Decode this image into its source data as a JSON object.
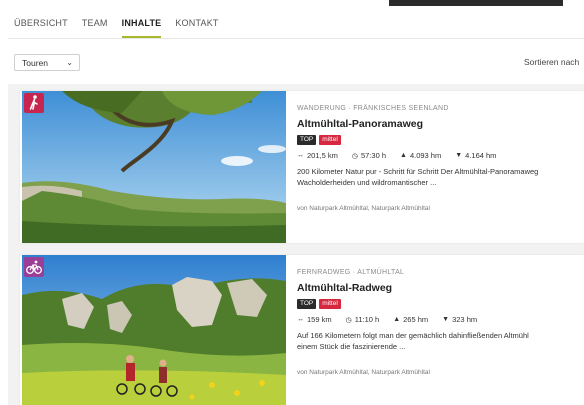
{
  "tabs": [
    {
      "label": "ÜBERSICHT"
    },
    {
      "label": "TEAM"
    },
    {
      "label": "INHALTE"
    },
    {
      "label": "KONTAKT"
    }
  ],
  "active_tab": "INHALTE",
  "filter": {
    "selected": "Touren"
  },
  "sort": {
    "label": "Sortieren nach"
  },
  "colors": {
    "accent": "#a7b92b",
    "hike_badge": "#c7264f",
    "bike_badge": "#9a3e98",
    "difficulty_badge": "#d6293f"
  },
  "tours": [
    {
      "category_icon": "hiking-icon",
      "meta": "WANDERUNG · FRÄNKISCHES SEENLAND",
      "title": "Altmühltal-Panoramaweg",
      "badge_top": "TOP",
      "badge_difficulty": "mittel",
      "distance": "201,5 km",
      "duration": "57:30 h",
      "ascent": "4.093 hm",
      "descent": "4.164 hm",
      "desc_line1": "200 Kilometer Natur pur - Schritt für Schritt Der Altmühltal-Panoramaweg",
      "desc_line2": "Wacholderheiden und wildromantischer ...",
      "author": "von Naturpark Altmühltal,  Naturpark Altmühltal"
    },
    {
      "category_icon": "cycling-icon",
      "meta": "FERNRADWEG · ALTMÜHLTAL",
      "title": "Altmühltal-Radweg",
      "badge_top": "TOP",
      "badge_difficulty": "mittel",
      "distance": "159 km",
      "duration": "11:10 h",
      "ascent": "265 hm",
      "descent": "323 hm",
      "desc_line1": "Auf 166 Kilometern folgt man der gemächlich dahinfließenden Altmühl",
      "desc_line2": "einem Stück die faszinierende ...",
      "author": "von Naturpark Altmühltal,  Naturpark Altmühltal"
    }
  ]
}
